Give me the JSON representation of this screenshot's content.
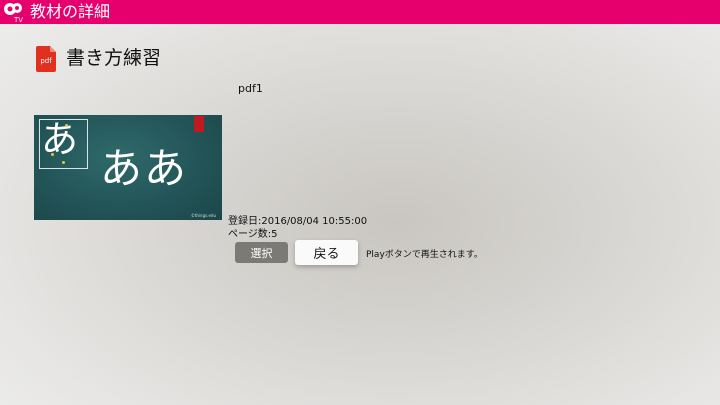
{
  "header": {
    "title": "教材の詳細",
    "logo_text": "TV",
    "background_color": "#e6006e"
  },
  "material": {
    "icon": "pdf-icon",
    "icon_label": "pdf",
    "title": "書き方練習",
    "file_name": "pdf1",
    "thumbnail": {
      "small_char": "あ",
      "large_chars": "ああ",
      "credit": "©things.edu"
    },
    "registered": "登録日:2016/08/04 10:55:00",
    "pages": "ページ数:5"
  },
  "actions": {
    "select_label": "選択",
    "back_label": "戻る",
    "hint": "Playボタンで再生されます。"
  }
}
